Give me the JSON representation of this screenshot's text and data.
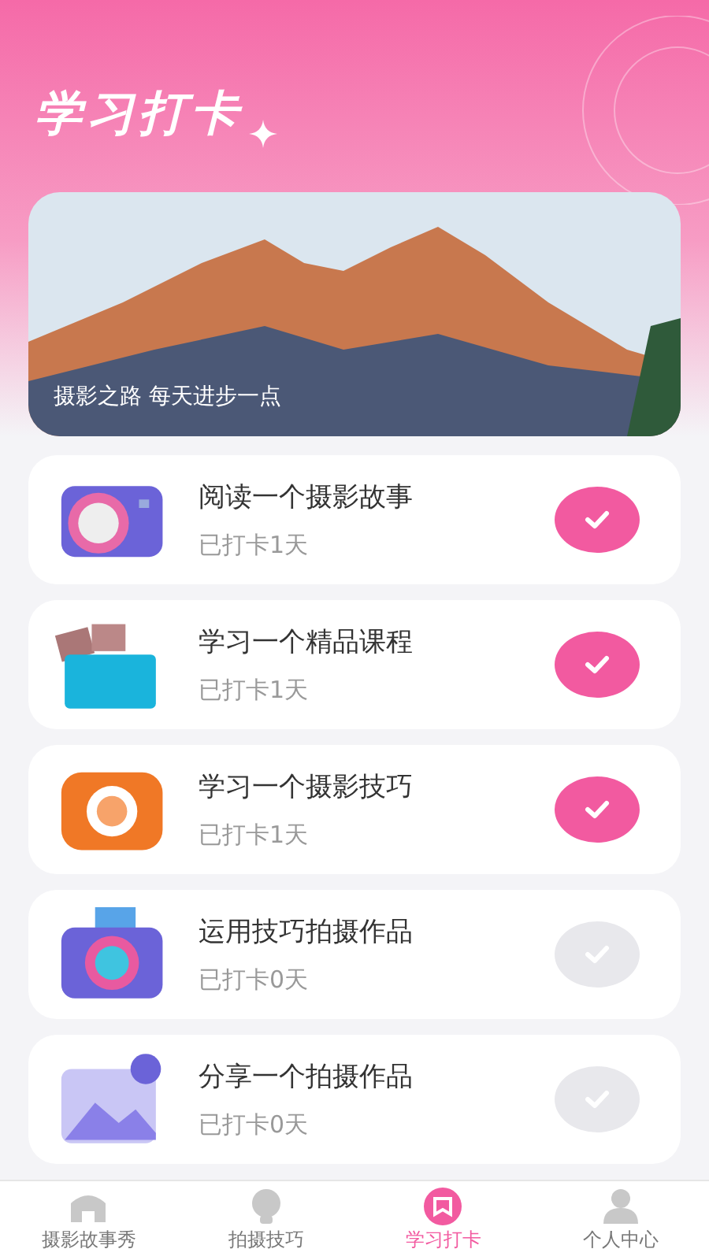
{
  "header": {
    "title": "学习打卡"
  },
  "banner": {
    "caption": "摄影之路 每天进步一点"
  },
  "tasks": [
    {
      "title": "阅读一个摄影故事",
      "status": "已打卡1天",
      "checked": true
    },
    {
      "title": "学习一个精品课程",
      "status": "已打卡1天",
      "checked": true
    },
    {
      "title": "学习一个摄影技巧",
      "status": "已打卡1天",
      "checked": true
    },
    {
      "title": "运用技巧拍摄作品",
      "status": "已打卡0天",
      "checked": false
    },
    {
      "title": "分享一个拍摄作品",
      "status": "已打卡0天",
      "checked": false
    }
  ],
  "tab_bar": [
    {
      "label": "摄影故事秀",
      "selected": false
    },
    {
      "label": "拍摄技巧",
      "selected": false
    },
    {
      "label": "学习打卡",
      "selected": true
    },
    {
      "label": "个人中心",
      "selected": false
    }
  ]
}
